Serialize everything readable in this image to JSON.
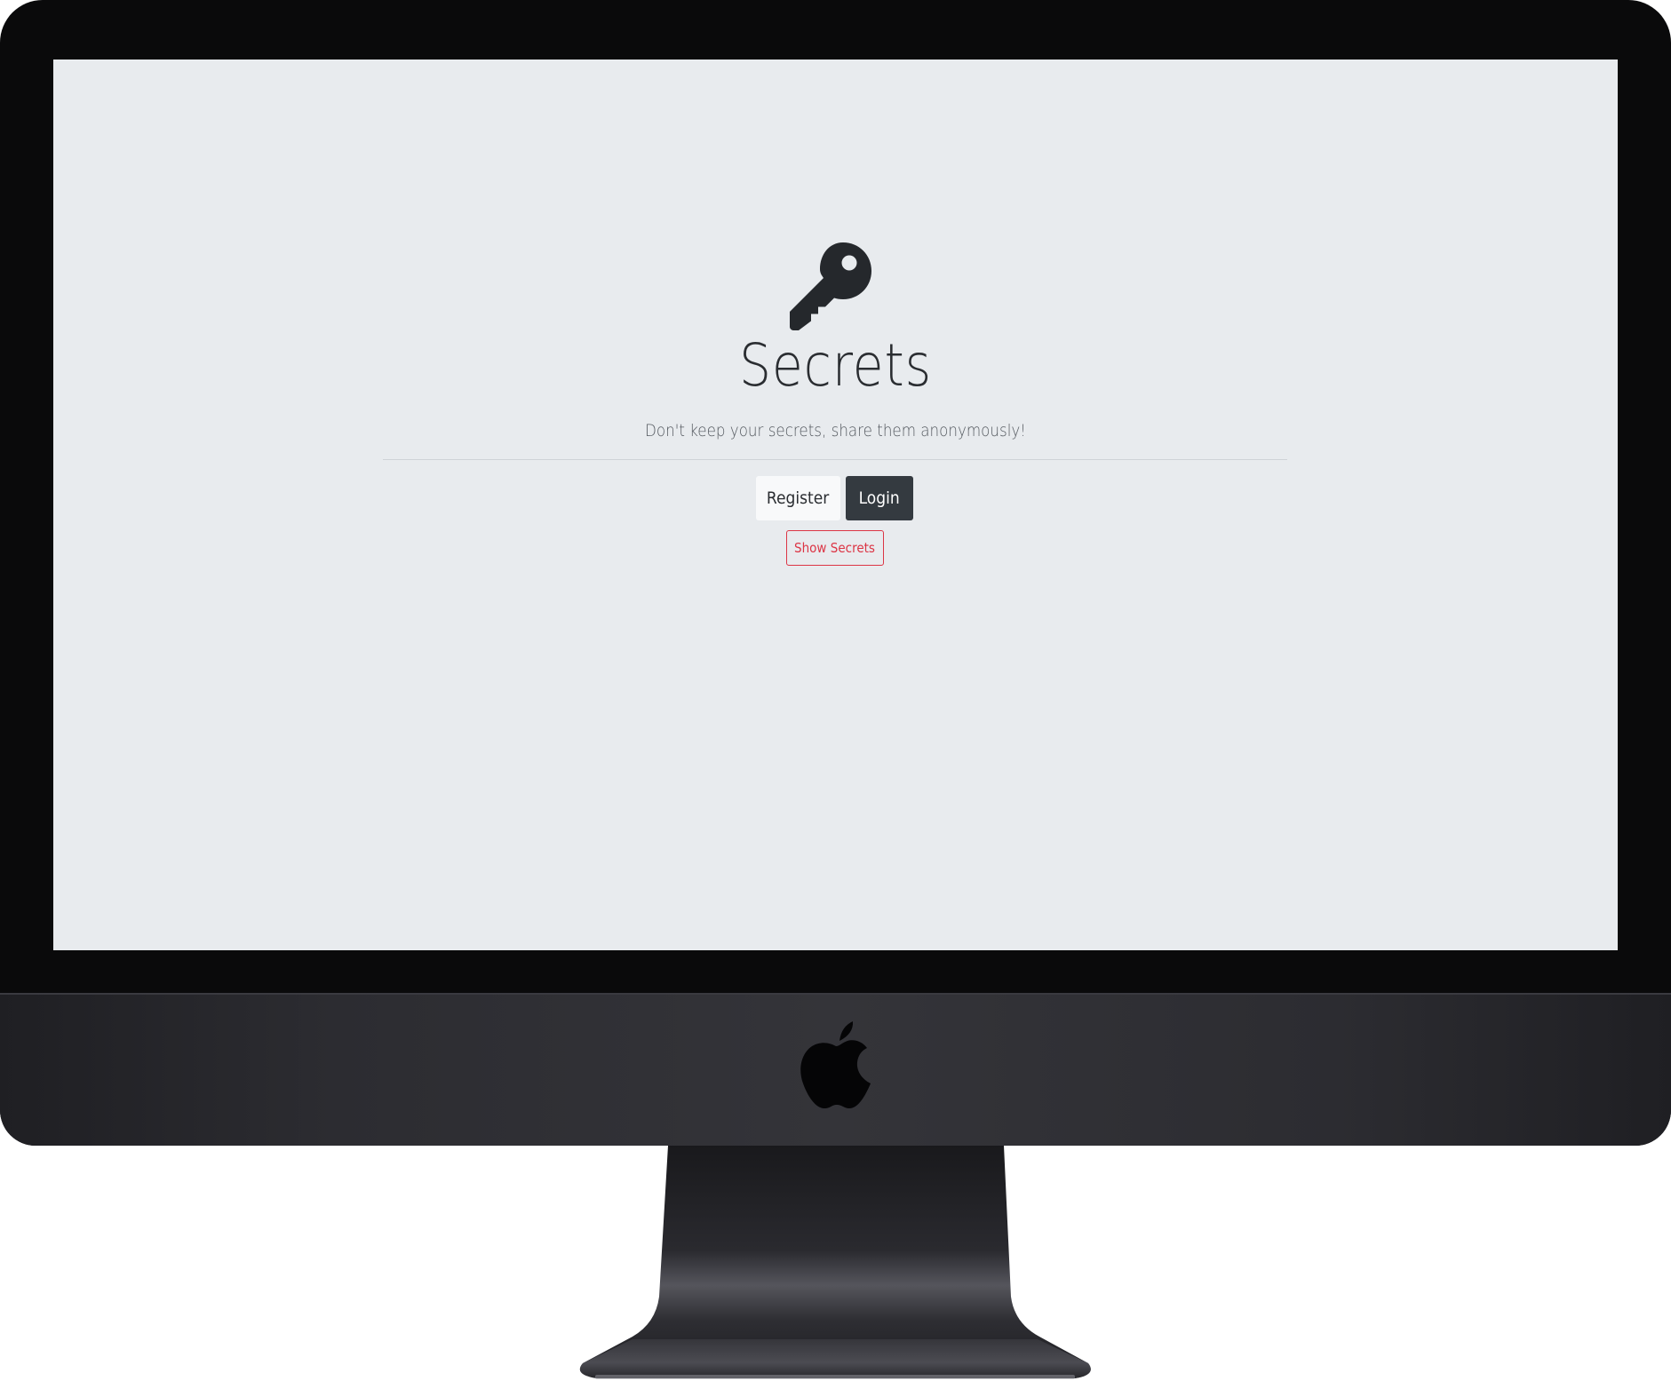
{
  "page": {
    "title": "Secrets",
    "subtitle": "Don't keep your secrets, share them anonymously!",
    "icon": "key-icon"
  },
  "buttons": {
    "register_label": "Register",
    "login_label": "Login",
    "show_secrets_label": "Show Secrets"
  },
  "device": {
    "logo": "apple-logo-icon"
  },
  "colors": {
    "screen_background": "#e8ebee",
    "text_dark": "#2a2d31",
    "login_background": "#343a40",
    "register_background": "#f8f9fa",
    "danger": "#dc3545"
  }
}
